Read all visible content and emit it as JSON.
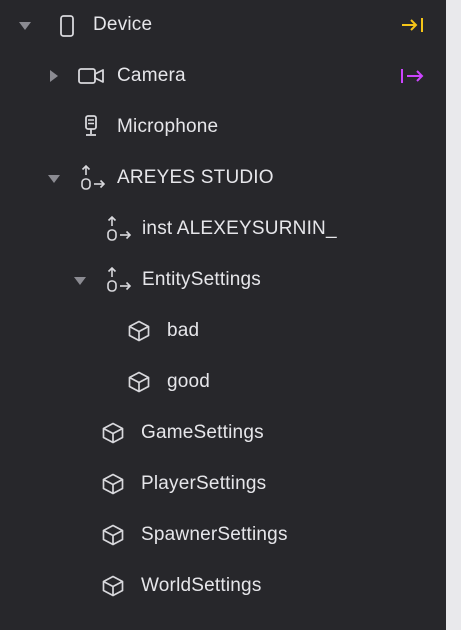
{
  "colors": {
    "panel_bg": "#27272b",
    "text": "#e6e6ea",
    "icon": "#d8d8dc",
    "arrow": "#8b8b92",
    "device_action": "#f5c518",
    "camera_action": "#cc44ff"
  },
  "tree": {
    "device": {
      "label": "Device",
      "icon": "phone-icon",
      "expanded": true,
      "action_icon": "align-right-arrow-icon"
    },
    "camera": {
      "label": "Camera",
      "icon": "camera-icon",
      "expanded": false,
      "action_icon": "arrow-right-icon"
    },
    "microphone": {
      "label": "Microphone",
      "icon": "microphone-icon"
    },
    "areyes_studio": {
      "label": "AREYES STUDIO",
      "icon": "prefab-arrows-icon",
      "expanded": true
    },
    "inst": {
      "label": "inst ALEXEYSURNIN_",
      "icon": "prefab-arrows-icon"
    },
    "entity_settings": {
      "label": "EntitySettings",
      "icon": "prefab-arrows-icon",
      "expanded": true
    },
    "bad": {
      "label": "bad",
      "icon": "cube-icon"
    },
    "good": {
      "label": "good",
      "icon": "cube-icon"
    },
    "game_settings": {
      "label": "GameSettings",
      "icon": "cube-icon"
    },
    "player_settings": {
      "label": "PlayerSettings",
      "icon": "cube-icon"
    },
    "spawner_settings": {
      "label": "SpawnerSettings",
      "icon": "cube-icon"
    },
    "world_settings": {
      "label": "WorldSettings",
      "icon": "cube-icon"
    }
  }
}
